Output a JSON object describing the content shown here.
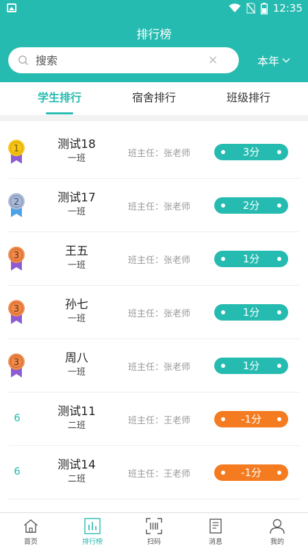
{
  "status_bar": {
    "time": "12:35"
  },
  "header": {
    "title": "排行榜",
    "search_placeholder": "搜索",
    "clear_symbol": "×",
    "period_label": "本年"
  },
  "tabs": [
    {
      "label": "学生排行",
      "active": true
    },
    {
      "label": "宿舍排行",
      "active": false
    },
    {
      "label": "班级排行",
      "active": false
    }
  ],
  "rankings": [
    {
      "rank": "1",
      "medal": "gold",
      "name": "测试18",
      "class": "一班",
      "teacher": "班主任：张老师",
      "score": "3分",
      "negative": false
    },
    {
      "rank": "2",
      "medal": "silver",
      "name": "测试17",
      "class": "一班",
      "teacher": "班主任：张老师",
      "score": "2分",
      "negative": false
    },
    {
      "rank": "3",
      "medal": "bronze",
      "name": "王五",
      "class": "一班",
      "teacher": "班主任：张老师",
      "score": "1分",
      "negative": false
    },
    {
      "rank": "3",
      "medal": "bronze",
      "name": "孙七",
      "class": "一班",
      "teacher": "班主任：张老师",
      "score": "1分",
      "negative": false
    },
    {
      "rank": "3",
      "medal": "bronze",
      "name": "周八",
      "class": "一班",
      "teacher": "班主任：张老师",
      "score": "1分",
      "negative": false
    },
    {
      "rank": "6",
      "medal": "",
      "name": "测试11",
      "class": "二班",
      "teacher": "班主任：王老师",
      "score": "-1分",
      "negative": true
    },
    {
      "rank": "6",
      "medal": "",
      "name": "测试14",
      "class": "二班",
      "teacher": "班主任：王老师",
      "score": "-1分",
      "negative": true
    }
  ],
  "bottom_nav": [
    {
      "label": "首页",
      "icon": "home-icon",
      "active": false
    },
    {
      "label": "排行榜",
      "icon": "chart-icon",
      "active": true
    },
    {
      "label": "扫码",
      "icon": "scan-icon",
      "active": false
    },
    {
      "label": "消息",
      "icon": "message-icon",
      "active": false
    },
    {
      "label": "我的",
      "icon": "user-icon",
      "active": false
    }
  ],
  "colors": {
    "primary": "#26bbb0",
    "negative": "#f47b20",
    "gold": "#f5c518",
    "silver": "#a9b9d6",
    "bronze": "#f08a4b",
    "ribbon": "#8e5bd6"
  }
}
